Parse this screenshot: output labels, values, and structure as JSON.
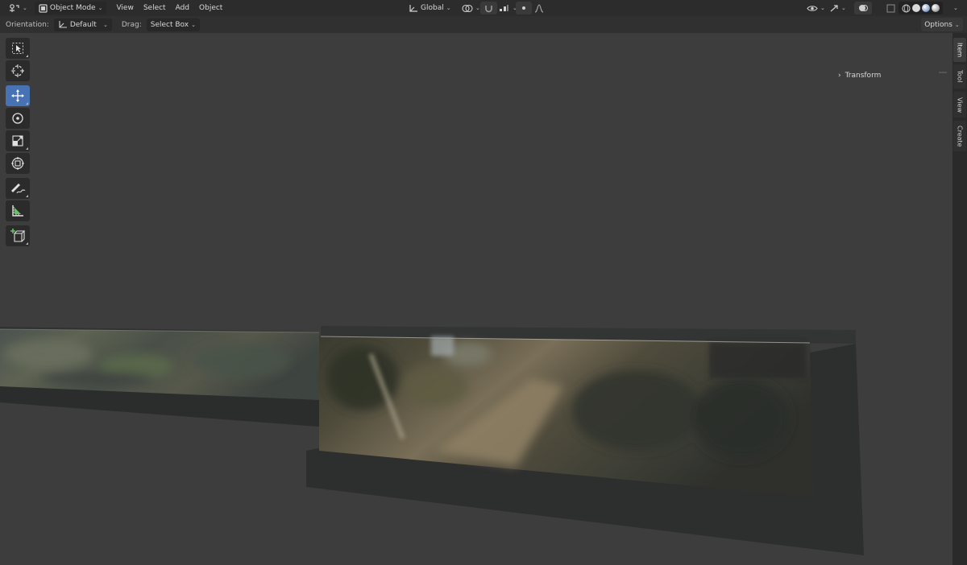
{
  "header": {
    "editor_icon": "viewport-editor-icon",
    "mode": "Object Mode",
    "menus": [
      "View",
      "Select",
      "Add",
      "Object"
    ],
    "transform_orientation": "Global"
  },
  "tool_header": {
    "orientation_label": "Orientation:",
    "orientation_value": "Default",
    "drag_label": "Drag:",
    "drag_value": "Select Box",
    "options_label": "Options"
  },
  "toolbar": {
    "tools": [
      {
        "name": "select-box",
        "icon": "cursor-select-icon",
        "active": false
      },
      {
        "name": "cursor",
        "icon": "3d-cursor-icon",
        "active": false
      },
      {
        "name": "move",
        "icon": "move-arrows-icon",
        "active": true
      },
      {
        "name": "rotate",
        "icon": "rotate-icon",
        "active": false
      },
      {
        "name": "scale",
        "icon": "scale-icon",
        "active": false
      },
      {
        "name": "transform",
        "icon": "transform-icon",
        "active": false
      },
      {
        "name": "annotate",
        "icon": "annotate-pencil-icon",
        "active": false
      },
      {
        "name": "measure",
        "icon": "measure-ruler-icon",
        "active": false
      },
      {
        "name": "add-cube",
        "icon": "add-cube-icon",
        "active": false
      }
    ]
  },
  "sidebar": {
    "tabs": [
      "Item",
      "Tool",
      "View",
      "Create"
    ],
    "active_tab": "Item",
    "panel_title": "Transform"
  },
  "colors": {
    "accent": "#4772b3",
    "viewport_bg": "#3d3d3d",
    "header_bg": "#2c2c2c"
  }
}
